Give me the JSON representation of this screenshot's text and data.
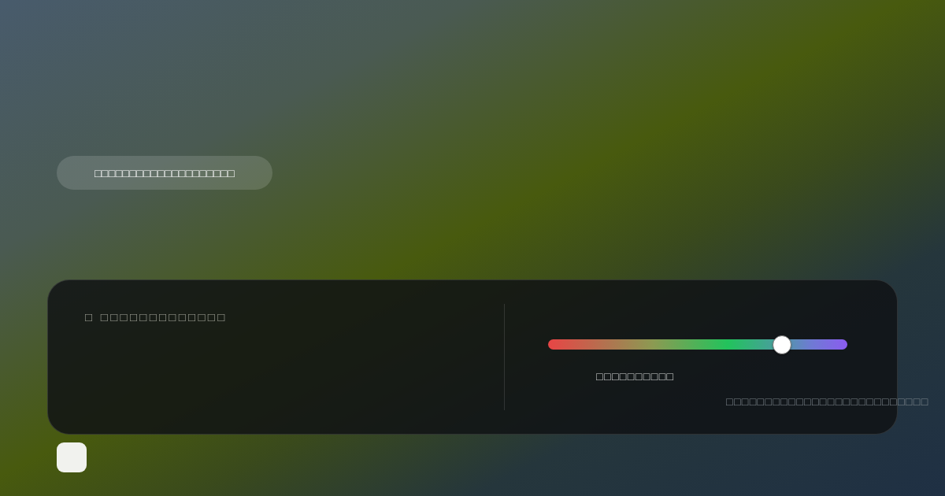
{
  "caption_pill": {
    "text": "□□□□□□□□□□□□□□□□□□□□"
  },
  "panel": {
    "heading": "□ □□□□□□□□□□□□□",
    "slider": {
      "level": 0.78,
      "label": "□□□□□□□□□□"
    },
    "footnote": "□□□□□□□□□□□□□□□□□□□□□□□□□□"
  }
}
